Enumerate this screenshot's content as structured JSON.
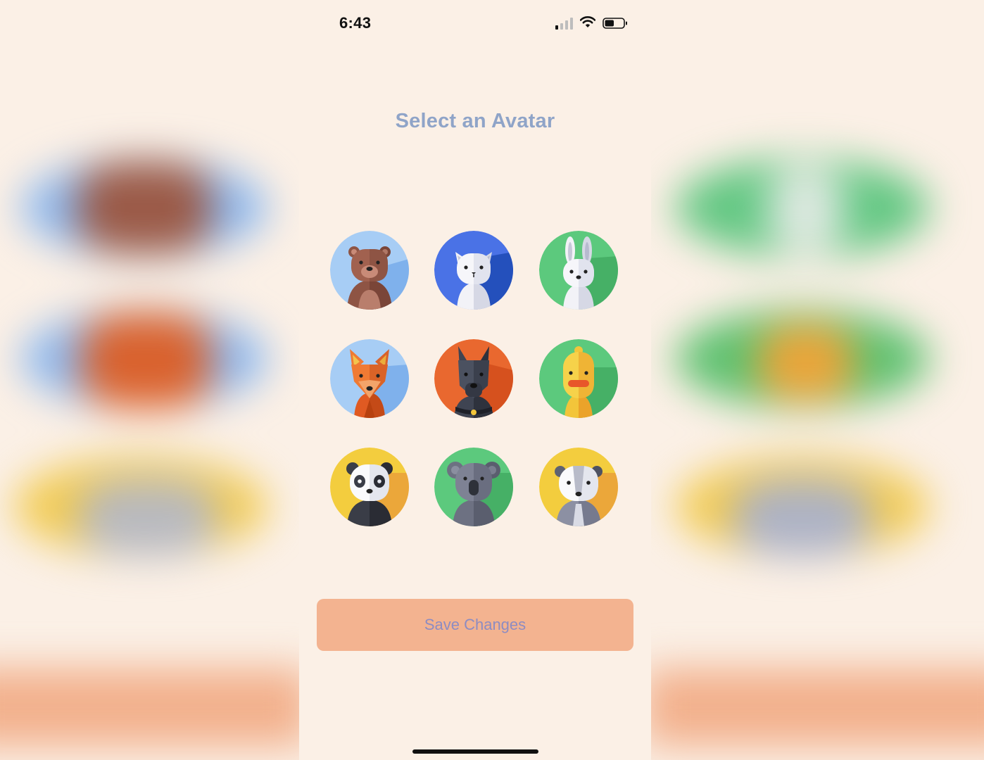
{
  "status_bar": {
    "time": "6:43",
    "signal_icon": "cellular-signal-icon",
    "wifi_icon": "wifi-icon",
    "battery_icon": "battery-icon",
    "battery_level": 0.5
  },
  "page": {
    "title": "Select an Avatar"
  },
  "avatars": [
    {
      "animal": "bear",
      "icon": "bear-avatar-icon",
      "background": "#A7CDF5"
    },
    {
      "animal": "cat",
      "icon": "cat-avatar-icon",
      "background": "#4A72E6"
    },
    {
      "animal": "rabbit",
      "icon": "rabbit-avatar-icon",
      "background": "#5CC97D"
    },
    {
      "animal": "fox",
      "icon": "fox-avatar-icon",
      "background": "#A7CDF5"
    },
    {
      "animal": "dog",
      "icon": "dog-avatar-icon",
      "background": "#E9682F"
    },
    {
      "animal": "duck",
      "icon": "duck-avatar-icon",
      "background": "#5CC97D"
    },
    {
      "animal": "panda",
      "icon": "panda-avatar-icon",
      "background": "#F3CD3E"
    },
    {
      "animal": "koala",
      "icon": "koala-avatar-icon",
      "background": "#5CC97D"
    },
    {
      "animal": "badger",
      "icon": "badger-avatar-icon",
      "background": "#F3CD3E"
    }
  ],
  "actions": {
    "save_label": "Save Changes"
  },
  "colors": {
    "page_background": "#FBF0E6",
    "title": "#8FA4C8",
    "button_background": "#F3B390",
    "button_text": "#8D8CC2"
  }
}
